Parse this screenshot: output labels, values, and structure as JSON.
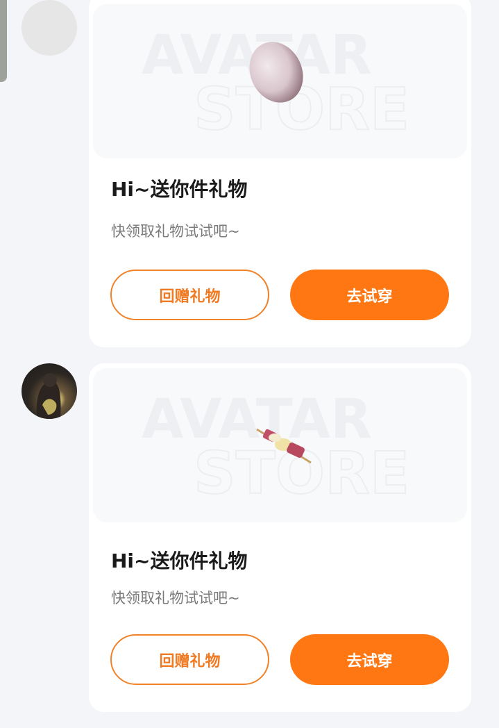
{
  "colors": {
    "background": "#f3f5f8",
    "card": "#ffffff",
    "accent": "#ff7712",
    "title": "#1a1a1a",
    "subtitle": "#7a7a7a"
  },
  "messages": [
    {
      "avatar": "empty-avatar",
      "item_icon": "egg-icon",
      "watermark": {
        "line1": "AVATAR",
        "line2": "STORE"
      },
      "title": "Hi~送你件礼物",
      "subtitle": "快领取礼物试试吧~",
      "return_gift_label": "回赠礼物",
      "try_on_label": "去试穿"
    },
    {
      "avatar": "user-photo-avatar",
      "item_icon": "skewer-icon",
      "watermark": {
        "line1": "AVATAR",
        "line2": "STORE"
      },
      "title": "Hi~送你件礼物",
      "subtitle": "快领取礼物试试吧~",
      "return_gift_label": "回赠礼物",
      "try_on_label": "去试穿"
    }
  ]
}
